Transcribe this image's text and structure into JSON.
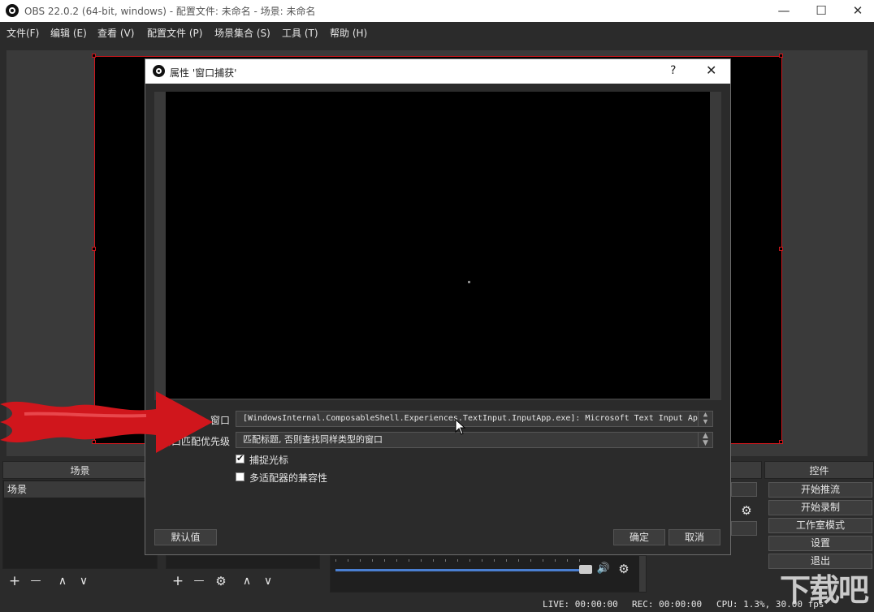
{
  "window": {
    "title": "OBS 22.0.2 (64-bit, windows) - 配置文件: 未命名 - 场景: 未命名",
    "minimize_glyph": "—",
    "maximize_glyph": "☐",
    "close_glyph": "✕"
  },
  "menu": {
    "items": [
      "文件(F)",
      "编辑 (E)",
      "查看 (V)",
      "配置文件 (P)",
      "场景集合 (S)",
      "工具 (T)",
      "帮助 (H)"
    ]
  },
  "docks": {
    "scenes": {
      "header": "场景",
      "items": [
        "场景"
      ]
    },
    "controls": {
      "header": "控件",
      "buttons": [
        "开始推流",
        "开始录制",
        "工作室模式",
        "设置",
        "退出"
      ]
    },
    "toolbar_glyphs": {
      "add": "+",
      "remove": "—",
      "up": "∧",
      "down": "∨",
      "gear": "⚙",
      "speaker": "🔊"
    }
  },
  "statusbar": {
    "live": "LIVE: 00:00:00",
    "rec": "REC: 00:00:00",
    "cpu": "CPU: 1.3%, 30.00 fps"
  },
  "dialog": {
    "title": "属性 '窗口捕获'",
    "help_glyph": "?",
    "close_glyph": "✕",
    "window_label": "窗口",
    "window_value": "[WindowsInternal.ComposableShell.Experiences.TextInput.InputApp.exe]: Microsoft Text Input Ap",
    "priority_label": "窗口匹配优先级",
    "priority_value": "匹配标题, 否则查找同样类型的窗口",
    "capture_cursor_label": "捕捉光标",
    "capture_cursor_checked": true,
    "multi_adapter_label": "多适配器的兼容性",
    "multi_adapter_checked": false,
    "defaults_button": "默认值",
    "ok_button": "确定",
    "cancel_button": "取消"
  },
  "watermark": {
    "text": "下载吧"
  },
  "colors": {
    "accent_red": "#d0161c",
    "panel_dark": "#2b2b2b",
    "preview_black": "#000000"
  }
}
